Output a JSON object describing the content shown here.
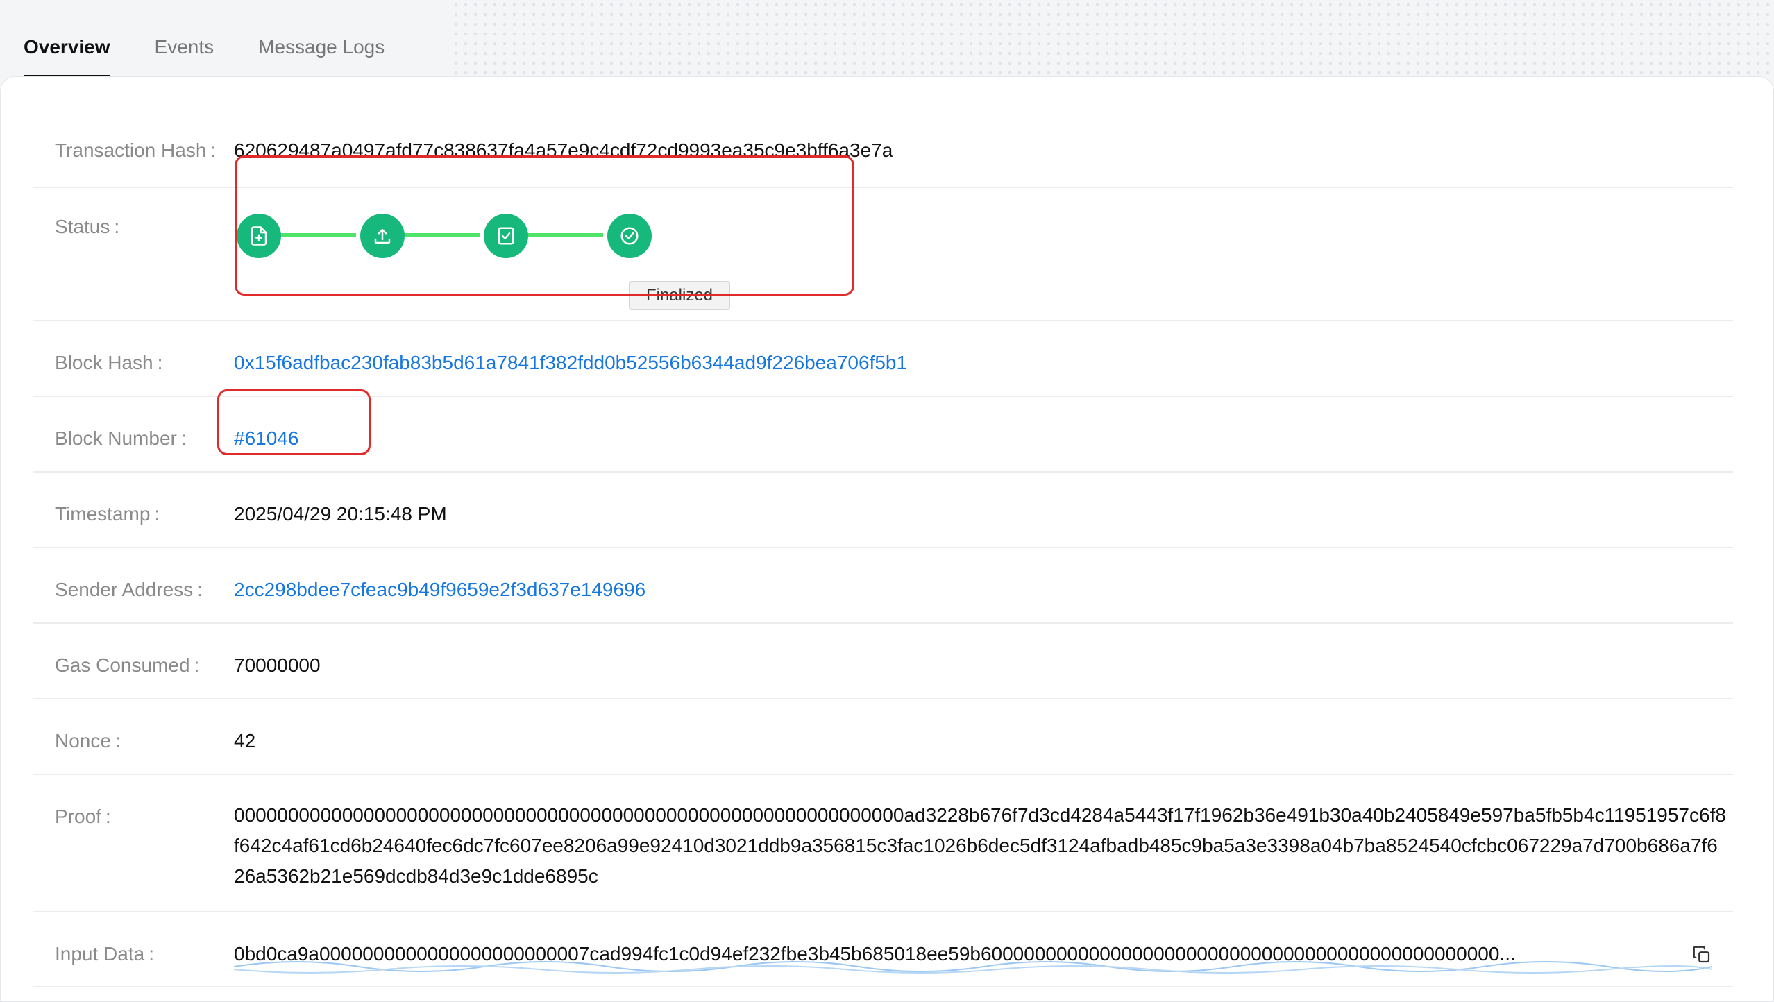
{
  "tabs": [
    {
      "label": "Overview",
      "active": true
    },
    {
      "label": "Events",
      "active": false
    },
    {
      "label": "Message Logs",
      "active": false
    }
  ],
  "labels": {
    "tx_hash": "Transaction Hash",
    "status": "Status",
    "block_hash": "Block Hash",
    "block_number": "Block Number",
    "timestamp": "Timestamp",
    "sender": "Sender Address",
    "gas": "Gas Consumed",
    "nonce": "Nonce",
    "proof": "Proof",
    "input": "Input Data"
  },
  "values": {
    "tx_hash": "620629487a0497afd77c838637fa4a57e9c4cdf72cd9993ea35c9e3bff6a3e7a",
    "status_badge": "Finalized",
    "block_hash": "0x15f6adfbac230fab83b5d61a7841f382fdd0b52556b6344ad9f226bea706f5b1",
    "block_number": "#61046",
    "timestamp": "2025/04/29 20:15:48 PM",
    "sender": "2cc298bdee7cfeac9b49f9659e2f3d637e149696",
    "gas": "70000000",
    "nonce": "42",
    "proof": "00000000000000000000000000000000000000000000000000000000000000ad3228b676f7d3cd4284a5443f17f1962b36e491b30a40b2405849e597ba5fb5b4c11951957c6f8f642c4af61cd6b24640fec6dc7fc607ee8206a99e92410d3021ddb9a356815c3fac1026b6dec5df3124afbadb485c9ba5a3e3398a04b7ba8524540cfcbc067229a7d700b686a7f626a5362b21e569dcdb84d3e9c1dde6895c",
    "input": "0bd0ca9a0000000000000000000000007cad994fc1c0d94ef232fbe3b45b685018ee59b600000000000000000000000000000000000000000000000..."
  },
  "status_steps": [
    {
      "icon": "file-plus-icon"
    },
    {
      "icon": "upload-icon"
    },
    {
      "icon": "file-check-icon"
    },
    {
      "icon": "check-circle-icon"
    }
  ],
  "colors": {
    "step_fill": "#16b87b",
    "step_line": "#4fe36a",
    "link": "#1677e0",
    "highlight": "#e12b2b"
  }
}
